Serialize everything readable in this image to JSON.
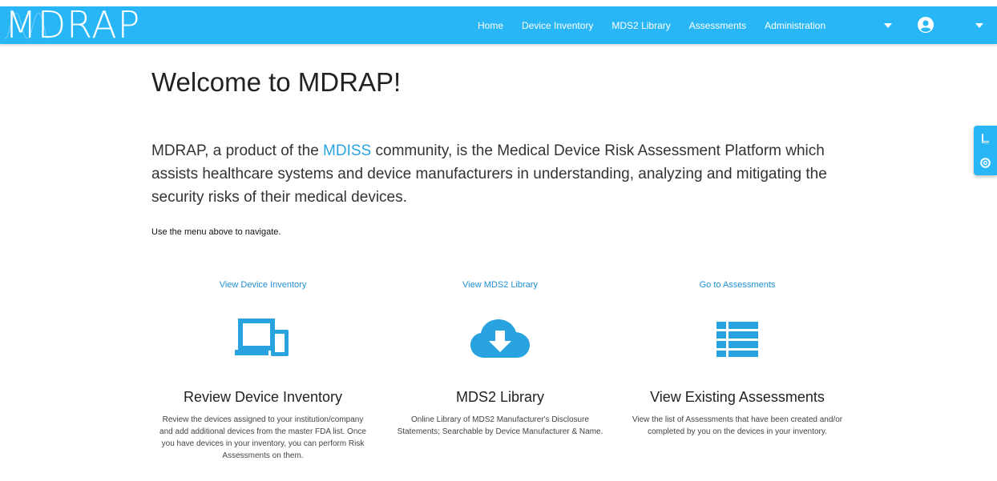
{
  "header": {
    "logo_text": "MDRAP",
    "nav": [
      "Home",
      "Device Inventory",
      "MDS2 Library",
      "Assessments",
      "Administration"
    ]
  },
  "main": {
    "title": "Welcome to MDRAP!",
    "intro_before": "MDRAP, a product of the ",
    "intro_link": "MDISS",
    "intro_after": " community, is the Medical Device Risk Assessment Platform which assists healthcare systems and device manufacturers in understanding, analyzing and mitigating the security risks of their medical devices.",
    "hint": "Use the menu above to navigate."
  },
  "cards": [
    {
      "link": "View Device Inventory",
      "icon": "devices-icon",
      "title": "Review Device Inventory",
      "desc": "Review the devices assigned to your institution/company and add additional devices from the master FDA list. Once you have devices in your inventory, you can perform Risk Assessments on them."
    },
    {
      "link": "View MDS2 Library",
      "icon": "cloud-download-icon",
      "title": "MDS2 Library",
      "desc": "Online Library of MDS2 Manufacturer's Disclosure Statements; Searchable by Device Manufacturer & Name."
    },
    {
      "link": "Go to Assessments",
      "icon": "list-icon",
      "title": "View Existing Assessments",
      "desc": "View the list of Assessments that have been created and/or completed by you on the devices in your inventory."
    }
  ],
  "colors": {
    "brand": "#29b6f6",
    "link": "#1f8fd6"
  },
  "side_tabs": [
    "book-icon",
    "lifebuoy-icon"
  ]
}
